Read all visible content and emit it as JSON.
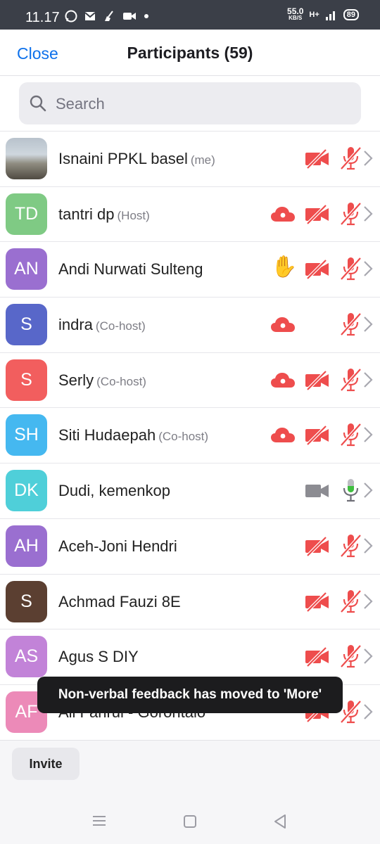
{
  "status_bar": {
    "time": "11.17",
    "speed_value": "55.0",
    "speed_unit": "KB/S",
    "network": "H+",
    "battery": "89"
  },
  "header": {
    "close_label": "Close",
    "title": "Participants (59)"
  },
  "search": {
    "placeholder": "Search"
  },
  "participants": [
    {
      "name": "Isnaini PPKL basel",
      "role": "(me)",
      "initials": "",
      "avatar": "photo",
      "cloud": false,
      "hand": false,
      "video": "off",
      "mic": "muted"
    },
    {
      "name": "tantri dp",
      "role": "(Host)",
      "initials": "TD",
      "avatar": "#7fca84",
      "cloud": true,
      "hand": false,
      "video": "off",
      "mic": "muted"
    },
    {
      "name": "Andi Nurwati Sulteng",
      "role": "",
      "initials": "AN",
      "avatar": "#9a6fd0",
      "cloud": false,
      "hand": true,
      "video": "off",
      "mic": "muted"
    },
    {
      "name": "indra",
      "role": "(Co-host)",
      "initials": "S",
      "avatar": "#5867c9",
      "cloud": true,
      "hand": false,
      "video": "none",
      "mic": "muted"
    },
    {
      "name": "Serly",
      "role": "(Co-host)",
      "initials": "S",
      "avatar": "#f25e5e",
      "cloud": true,
      "hand": false,
      "video": "off",
      "mic": "muted"
    },
    {
      "name": "Siti Hudaepah",
      "role": "(Co-host)",
      "initials": "SH",
      "avatar": "#45b8f0",
      "cloud": true,
      "hand": false,
      "video": "off",
      "mic": "muted"
    },
    {
      "name": "Dudi, kemenkop",
      "role": "",
      "initials": "DK",
      "avatar": "#4fcfd9",
      "cloud": false,
      "hand": false,
      "video": "on",
      "mic": "live"
    },
    {
      "name": "Aceh-Joni Hendri",
      "role": "",
      "initials": "AH",
      "avatar": "#9a6fd0",
      "cloud": false,
      "hand": false,
      "video": "off",
      "mic": "muted"
    },
    {
      "name": "Achmad Fauzi 8E",
      "role": "",
      "initials": "S",
      "avatar": "#5b3f31",
      "cloud": false,
      "hand": false,
      "video": "off",
      "mic": "muted"
    },
    {
      "name": "Agus S DIY",
      "role": "",
      "initials": "AS",
      "avatar": "#c283d8",
      "cloud": false,
      "hand": false,
      "video": "off",
      "mic": "muted"
    },
    {
      "name": "Ali Fahrul - Gorontalo",
      "role": "",
      "initials": "AF",
      "avatar": "#ec8ab8",
      "cloud": false,
      "hand": false,
      "video": "off",
      "mic": "muted"
    }
  ],
  "toast": {
    "text": "Non-verbal feedback has moved to 'More'"
  },
  "footer": {
    "invite_label": "Invite"
  },
  "icons": {
    "search": "search-icon",
    "cloud": "cloud-recording-icon",
    "hand": "raised-hand-icon",
    "video_off": "video-off-icon",
    "video_on": "video-icon",
    "mic_muted": "mic-muted-icon",
    "mic_live": "mic-live-icon",
    "chevron": "chevron-right-icon"
  },
  "colors": {
    "accent": "#0e71eb",
    "muted_red": "#ee4d4d",
    "live_green": "#3fbf3f",
    "video_gray": "#8c8c92"
  }
}
